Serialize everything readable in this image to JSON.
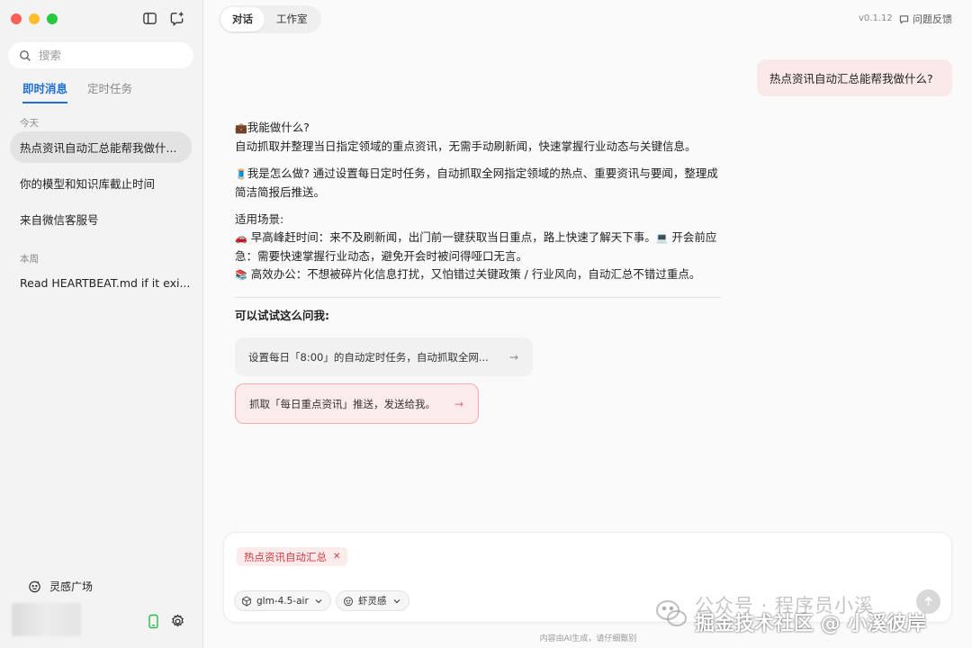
{
  "sidebar": {
    "search_placeholder": "搜索",
    "tabs": [
      {
        "label": "即时消息",
        "active": true
      },
      {
        "label": "定时任务",
        "active": false
      }
    ],
    "groups": [
      {
        "label": "今天",
        "items": [
          "热点资讯自动汇总能帮我做什...",
          "你的模型和知识库截止时间",
          "来自微信客服号"
        ]
      },
      {
        "label": "本周",
        "items": [
          "Read HEARTBEAT.md if it exi..."
        ]
      }
    ],
    "inspire_label": "灵感广场"
  },
  "main": {
    "tabs": [
      {
        "label": "对话",
        "active": true
      },
      {
        "label": "工作室",
        "active": false
      }
    ],
    "version": "v0.1.12",
    "feedback_label": "问题反馈",
    "user_message": "热点资讯自动汇总能帮我做什么?",
    "reply": {
      "what_title": "我能做什么?",
      "what_body": "自动抓取并整理当日指定领域的重点资讯，无需手动刷新闻，快速掌握行业动态与关键信息。",
      "how_body": "我是怎么做? 通过设置每日定时任务，自动抓取全网指定领域的热点、重要资讯与要闻，整理成简洁简报后推送。",
      "scenes_title": "适用场景:",
      "scene1": "早高峰赶时间：来不及刷新闻，出门前一键获取当日重点，路上快速了解天下事。",
      "scene2": "开会前应急：需要快速掌握行业动态，避免开会时被问得哑口无言。",
      "scene3": "高效办公：不想被碎片化信息打扰，又怕错过关键政策 / 行业风向，自动汇总不错过重点。",
      "try_title": "可以试试这么问我:",
      "suggestions": [
        "设置每日「8:00」的自动定时任务，自动抓取全网...",
        "抓取「每日重点资讯」推送，发送给我。"
      ]
    },
    "composer": {
      "chip": "热点资讯自动汇总",
      "model": "glm-4.5-air",
      "mode": "虾灵感"
    },
    "disclaimer": "内容由AI生成，请仔细甄别"
  },
  "watermark": {
    "line1": "公众号 · 程序员小溪",
    "line2": "掘金技术社区 @ 小溪彼岸"
  },
  "colors": {
    "accent": "#1f6fd6",
    "user_bubble": "#fbe9e9",
    "chip_text": "#cc3a45"
  }
}
